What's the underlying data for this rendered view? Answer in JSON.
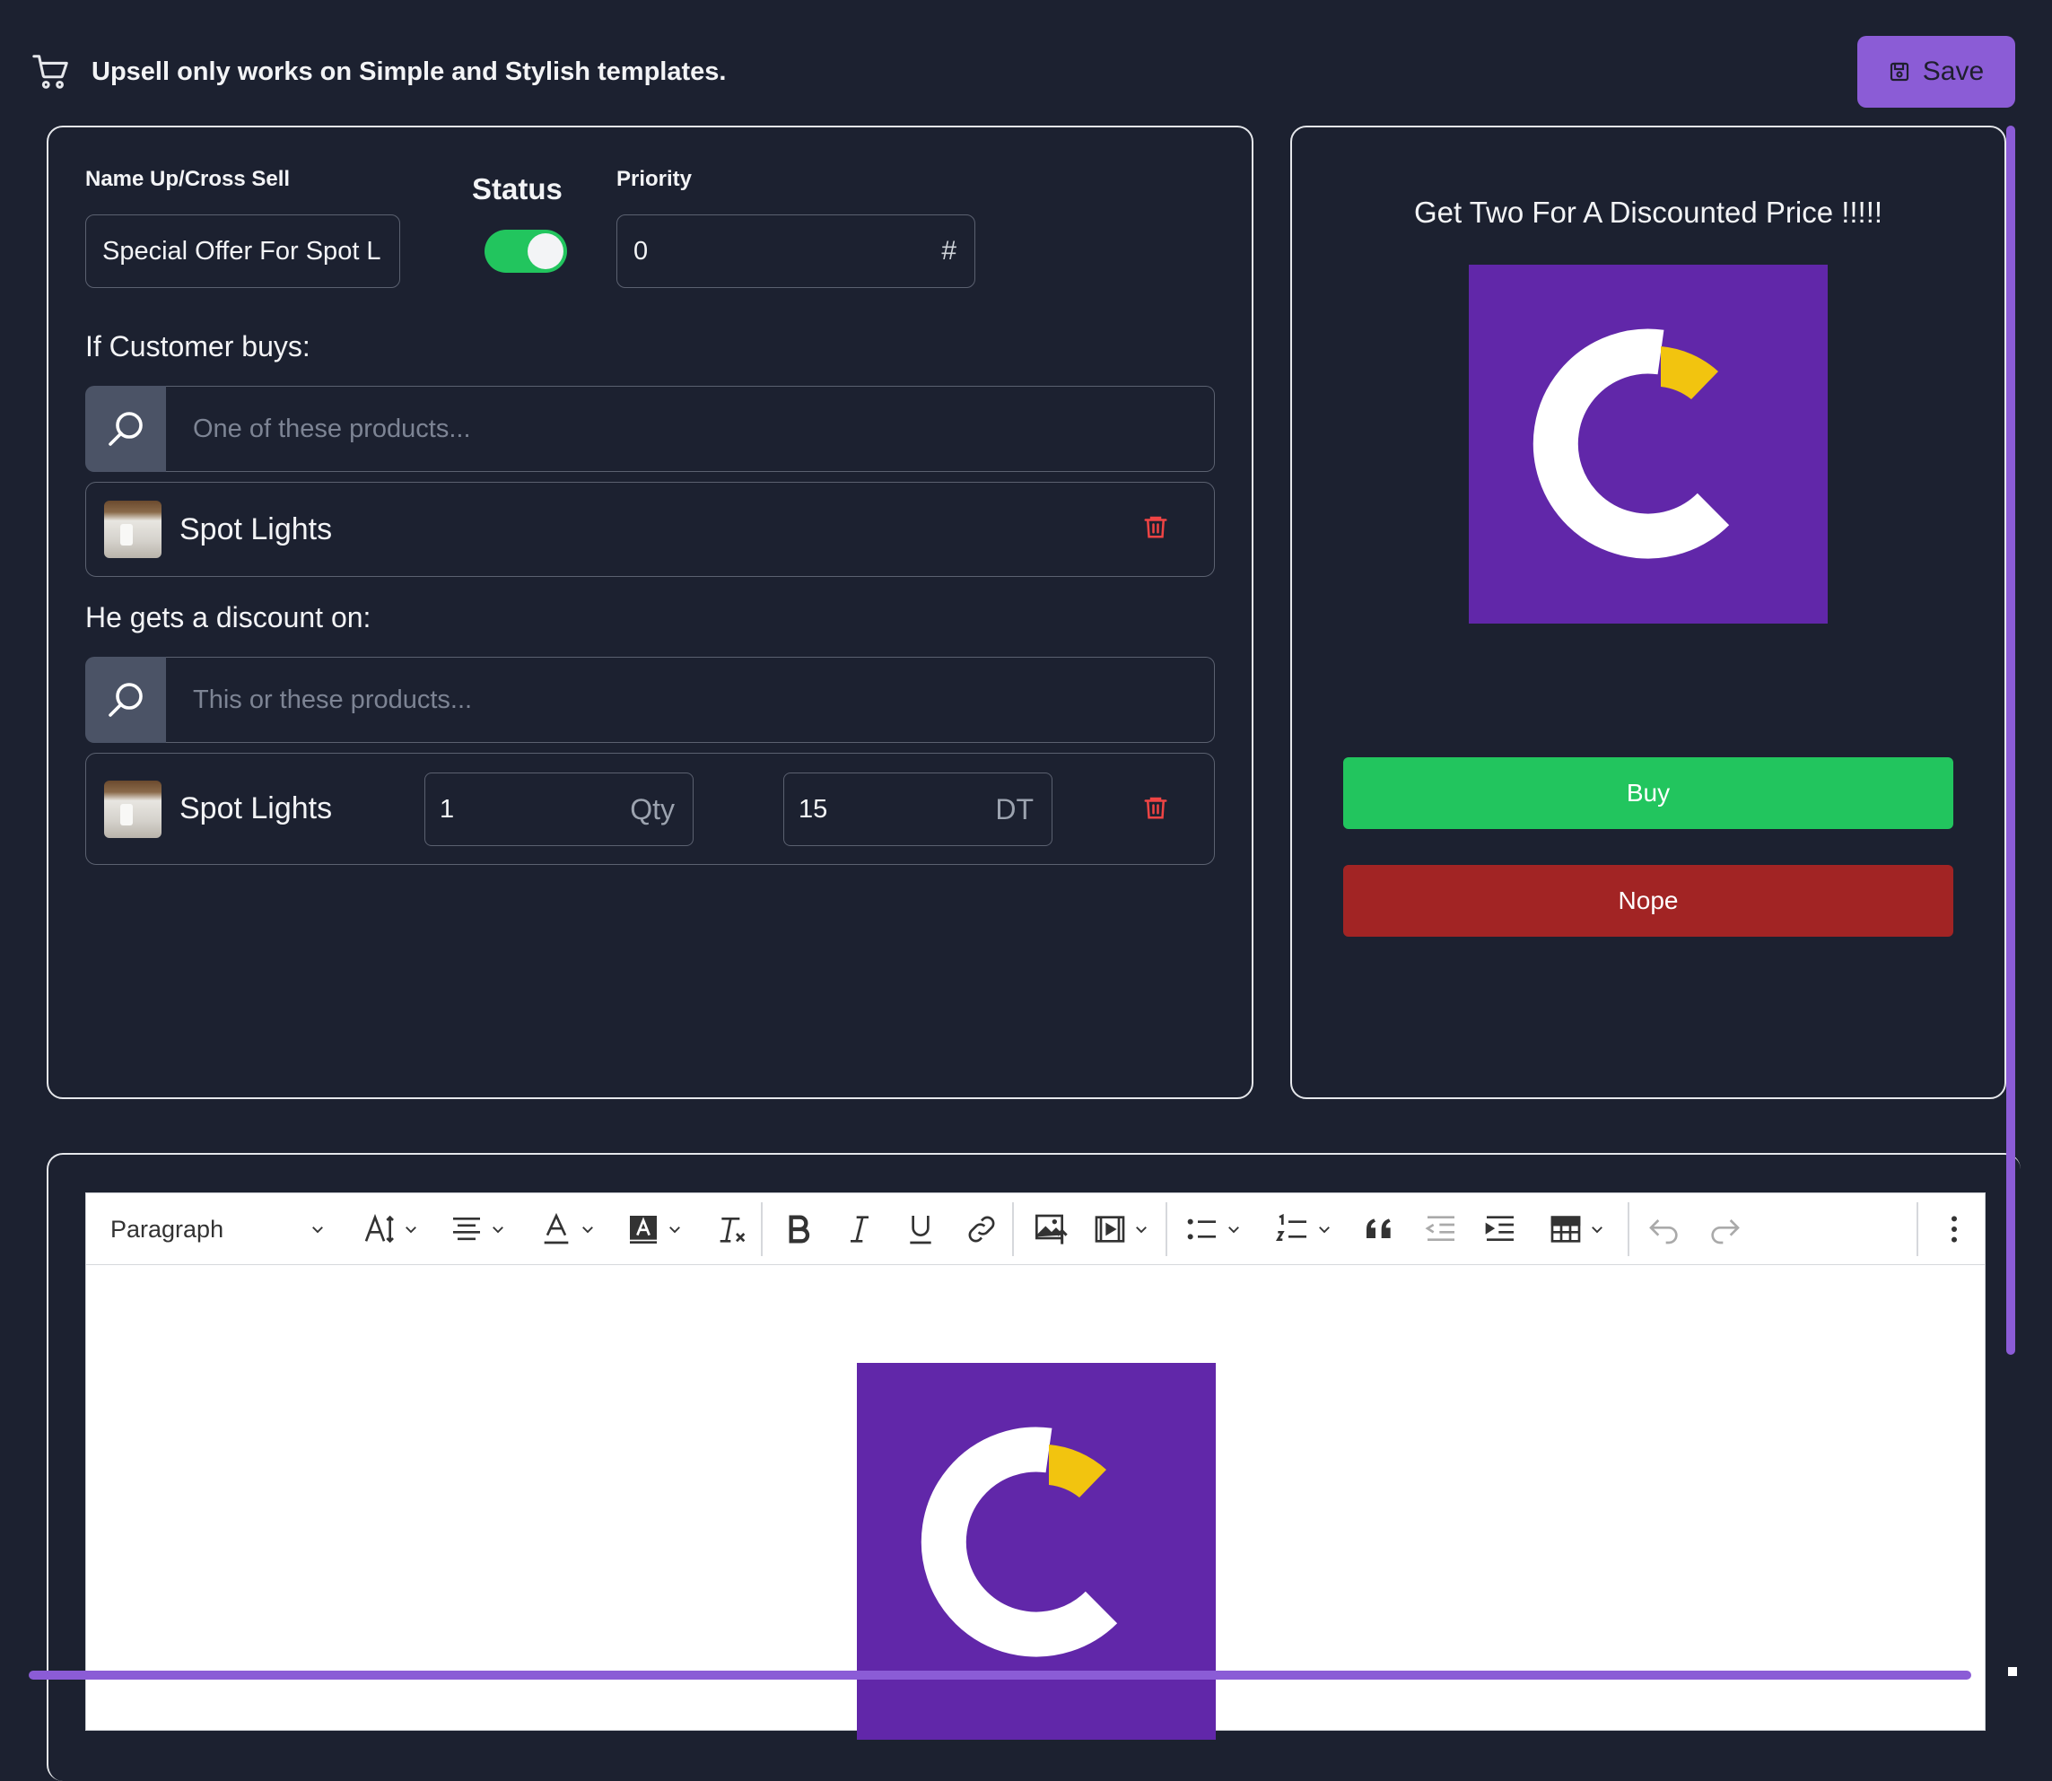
{
  "header": {
    "icon": "cart-icon",
    "notice": "Upsell only works on Simple and Stylish templates.",
    "save_label": "Save"
  },
  "form": {
    "name_label": "Name Up/Cross Sell",
    "name_value": "Special Offer For Spot L",
    "status_label": "Status",
    "status_on": true,
    "priority_label": "Priority",
    "priority_value": "0",
    "priority_suffix": "#",
    "trigger_label": "If Customer buys:",
    "trigger_placeholder": "One of these products...",
    "trigger_products": [
      {
        "name": "Spot Lights"
      }
    ],
    "discount_label": "He gets a discount on:",
    "discount_placeholder": "This or these products...",
    "discount_products": [
      {
        "name": "Spot Lights",
        "qty": "1",
        "qty_unit": "Qty",
        "price": "15",
        "currency": "DT"
      }
    ]
  },
  "preview": {
    "title": "Get Two For A Discounted Price !!!!!",
    "buy_label": "Buy",
    "nope_label": "Nope"
  },
  "editor": {
    "block_format": "Paragraph"
  },
  "colors": {
    "background": "#1c2130",
    "accent": "#8b5cd6",
    "buy": "#22c55e",
    "nope": "#a22424",
    "logo_bg": "#6127a9",
    "logo_yellow": "#f2c40f"
  }
}
